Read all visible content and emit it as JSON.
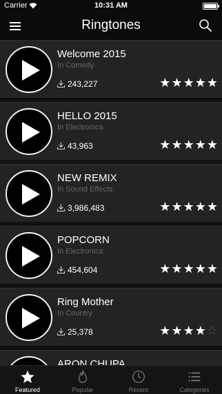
{
  "status_bar": {
    "carrier": "Carrier",
    "time": "10:31 AM"
  },
  "nav": {
    "title": "Ringtones"
  },
  "ringtones": [
    {
      "name": "Welcome 2015",
      "category": "In Comedy",
      "downloads": "243,227",
      "rating": 5
    },
    {
      "name": "HELLO 2015",
      "category": "In Electronica",
      "downloads": "43,963",
      "rating": 5
    },
    {
      "name": "NEW REMIX",
      "category": "In Sound Effects",
      "downloads": "3,986,483",
      "rating": 5
    },
    {
      "name": "POPCORN",
      "category": "In Electronica",
      "downloads": "454,604",
      "rating": 5
    },
    {
      "name": "Ring Mother",
      "category": "In Country",
      "downloads": "25,378",
      "rating": 4
    },
    {
      "name": "ARON CHUPA",
      "category": "",
      "downloads": "",
      "rating": 0
    }
  ],
  "tabs": [
    {
      "label": "Featured",
      "icon": "star-icon",
      "active": true
    },
    {
      "label": "Popular",
      "icon": "flame-icon",
      "active": false
    },
    {
      "label": "Recent",
      "icon": "clock-icon",
      "active": false
    },
    {
      "label": "Categories",
      "icon": "list-icon",
      "active": false
    }
  ],
  "colors": {
    "background": "#111111",
    "row": "#232323",
    "bar": "#0b0b0b",
    "text": "#ffffff",
    "muted": "#666666"
  }
}
